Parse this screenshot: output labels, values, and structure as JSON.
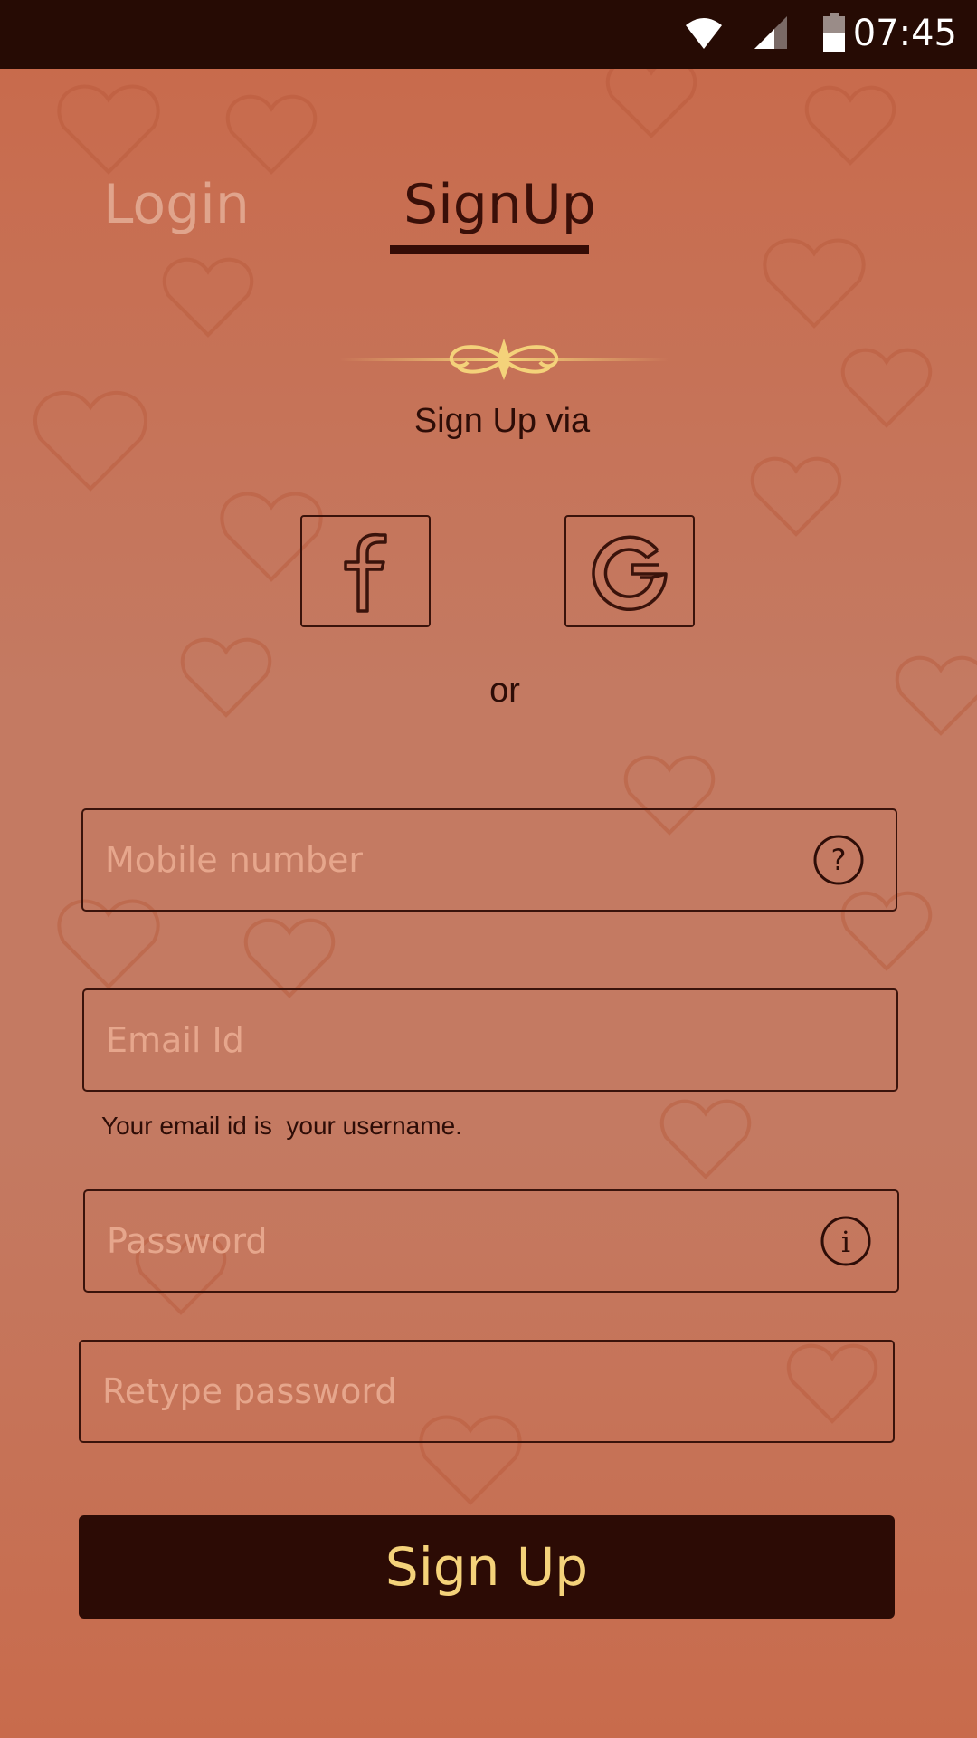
{
  "status_bar": {
    "time": "07:45",
    "icons": [
      "wifi-icon",
      "signal-icon",
      "battery-icon"
    ]
  },
  "tabs": [
    {
      "label": "Login",
      "active": false
    },
    {
      "label": "SignUp",
      "active": true
    }
  ],
  "signup_via_label": "Sign Up via",
  "social": [
    {
      "name": "facebook",
      "icon": "facebook-icon"
    },
    {
      "name": "google",
      "icon": "google-icon"
    }
  ],
  "or_label": "or",
  "form": {
    "mobile": {
      "value": "",
      "placeholder": "Mobile number",
      "icon": "help-icon"
    },
    "email": {
      "value": "",
      "placeholder": "Email Id",
      "hint": "Your email id is  your username."
    },
    "password": {
      "value": "",
      "placeholder": "Password",
      "icon": "info-icon"
    },
    "retype_password": {
      "value": "",
      "placeholder": "Retype password"
    }
  },
  "submit_label": "Sign Up",
  "colors": {
    "background": "#c47a62",
    "dark": "#2c0b05",
    "accent_gold": "#f4d27a",
    "placeholder": "#e6a68c",
    "inactive_tab": "#e0a48c"
  }
}
